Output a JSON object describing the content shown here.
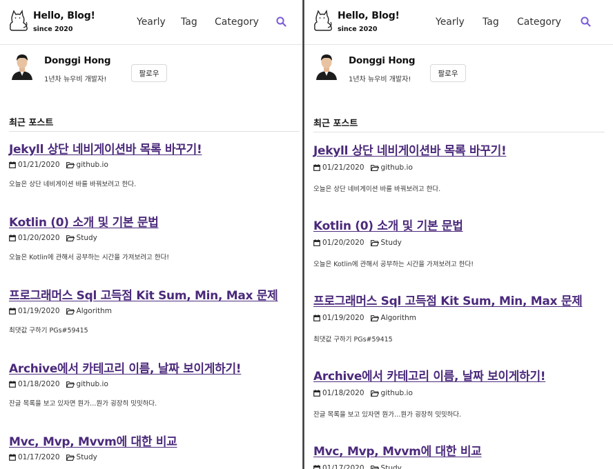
{
  "site": {
    "title": "Hello, Blog!",
    "subtitle": "since 2020"
  },
  "nav": {
    "items": [
      "Yearly",
      "Tag",
      "Category"
    ]
  },
  "author": {
    "name": "Donggi Hong",
    "bio": "1년차 뉴우비 개발자!",
    "follow_label": "팔로우"
  },
  "section_title": "최근 포스트",
  "posts": [
    {
      "title": "Jekyll 상단 네비게이션바 목록 바꾸기!",
      "date": "01/21/2020",
      "category": "github.io",
      "excerpt": "오늘은 상단 네비게이션 바를 바꿔보려고 한다."
    },
    {
      "title": "Kotlin (0) 소개 및 기본 문법",
      "date": "01/20/2020",
      "category": "Study",
      "excerpt": "오늘은 Kotlin에 관해서 공부하는 시간을 가져보려고 한다!"
    },
    {
      "title": "프로그래머스 Sql 고득점 Kit Sum, Min, Max 문제",
      "date": "01/19/2020",
      "category": "Algorithm",
      "excerpt": "최댓값 구하기 PGs#59415"
    },
    {
      "title": "Archive에서 카테고리 이름, 날짜 보이게하기!",
      "date": "01/18/2020",
      "category": "github.io",
      "excerpt": "잔글 목록을 보고 있자면 뭔가…뭔가 굉장히 밋밋하다."
    },
    {
      "title": "Mvc, Mvp, Mvvm에 대한 비교",
      "date": "01/17/2020",
      "category": "Study",
      "excerpt": ""
    }
  ],
  "colors": {
    "post_title": "#4b2a7b",
    "search_icon": "#7b5cd6"
  },
  "icons": {
    "logo": "cat-logo-icon",
    "search": "search-icon",
    "date": "calendar-icon",
    "category": "folder-icon"
  }
}
